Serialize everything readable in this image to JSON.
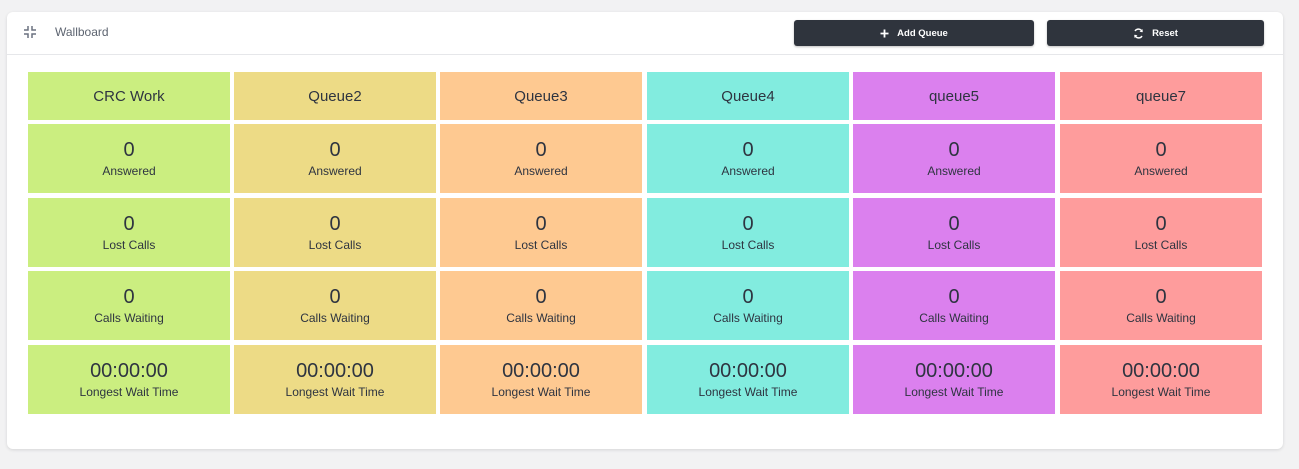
{
  "header": {
    "title": "Wallboard",
    "collapse_icon": "compress-icon",
    "add_queue_label": "Add Queue",
    "add_queue_icon": "plus-icon",
    "reset_label": "Reset",
    "reset_icon": "refresh-icon"
  },
  "stat_labels": {
    "answered": "Answered",
    "lost": "Lost Calls",
    "waiting": "Calls Waiting",
    "longest": "Longest Wait Time"
  },
  "queues": [
    {
      "name": "CRC Work",
      "color": "#cbee80",
      "answered": "0",
      "lost": "0",
      "waiting": "0",
      "longest": "00:00:00"
    },
    {
      "name": "Queue2",
      "color": "#eddb86",
      "answered": "0",
      "lost": "0",
      "waiting": "0",
      "longest": "00:00:00"
    },
    {
      "name": "Queue3",
      "color": "#fec991",
      "answered": "0",
      "lost": "0",
      "waiting": "0",
      "longest": "00:00:00"
    },
    {
      "name": "Queue4",
      "color": "#82ecdf",
      "answered": "0",
      "lost": "0",
      "waiting": "0",
      "longest": "00:00:00"
    },
    {
      "name": "queue5",
      "color": "#db80ee",
      "answered": "0",
      "lost": "0",
      "waiting": "0",
      "longest": "00:00:00"
    },
    {
      "name": "queue7",
      "color": "#fe9c9c",
      "answered": "0",
      "lost": "0",
      "waiting": "0",
      "longest": "00:00:00"
    }
  ]
}
